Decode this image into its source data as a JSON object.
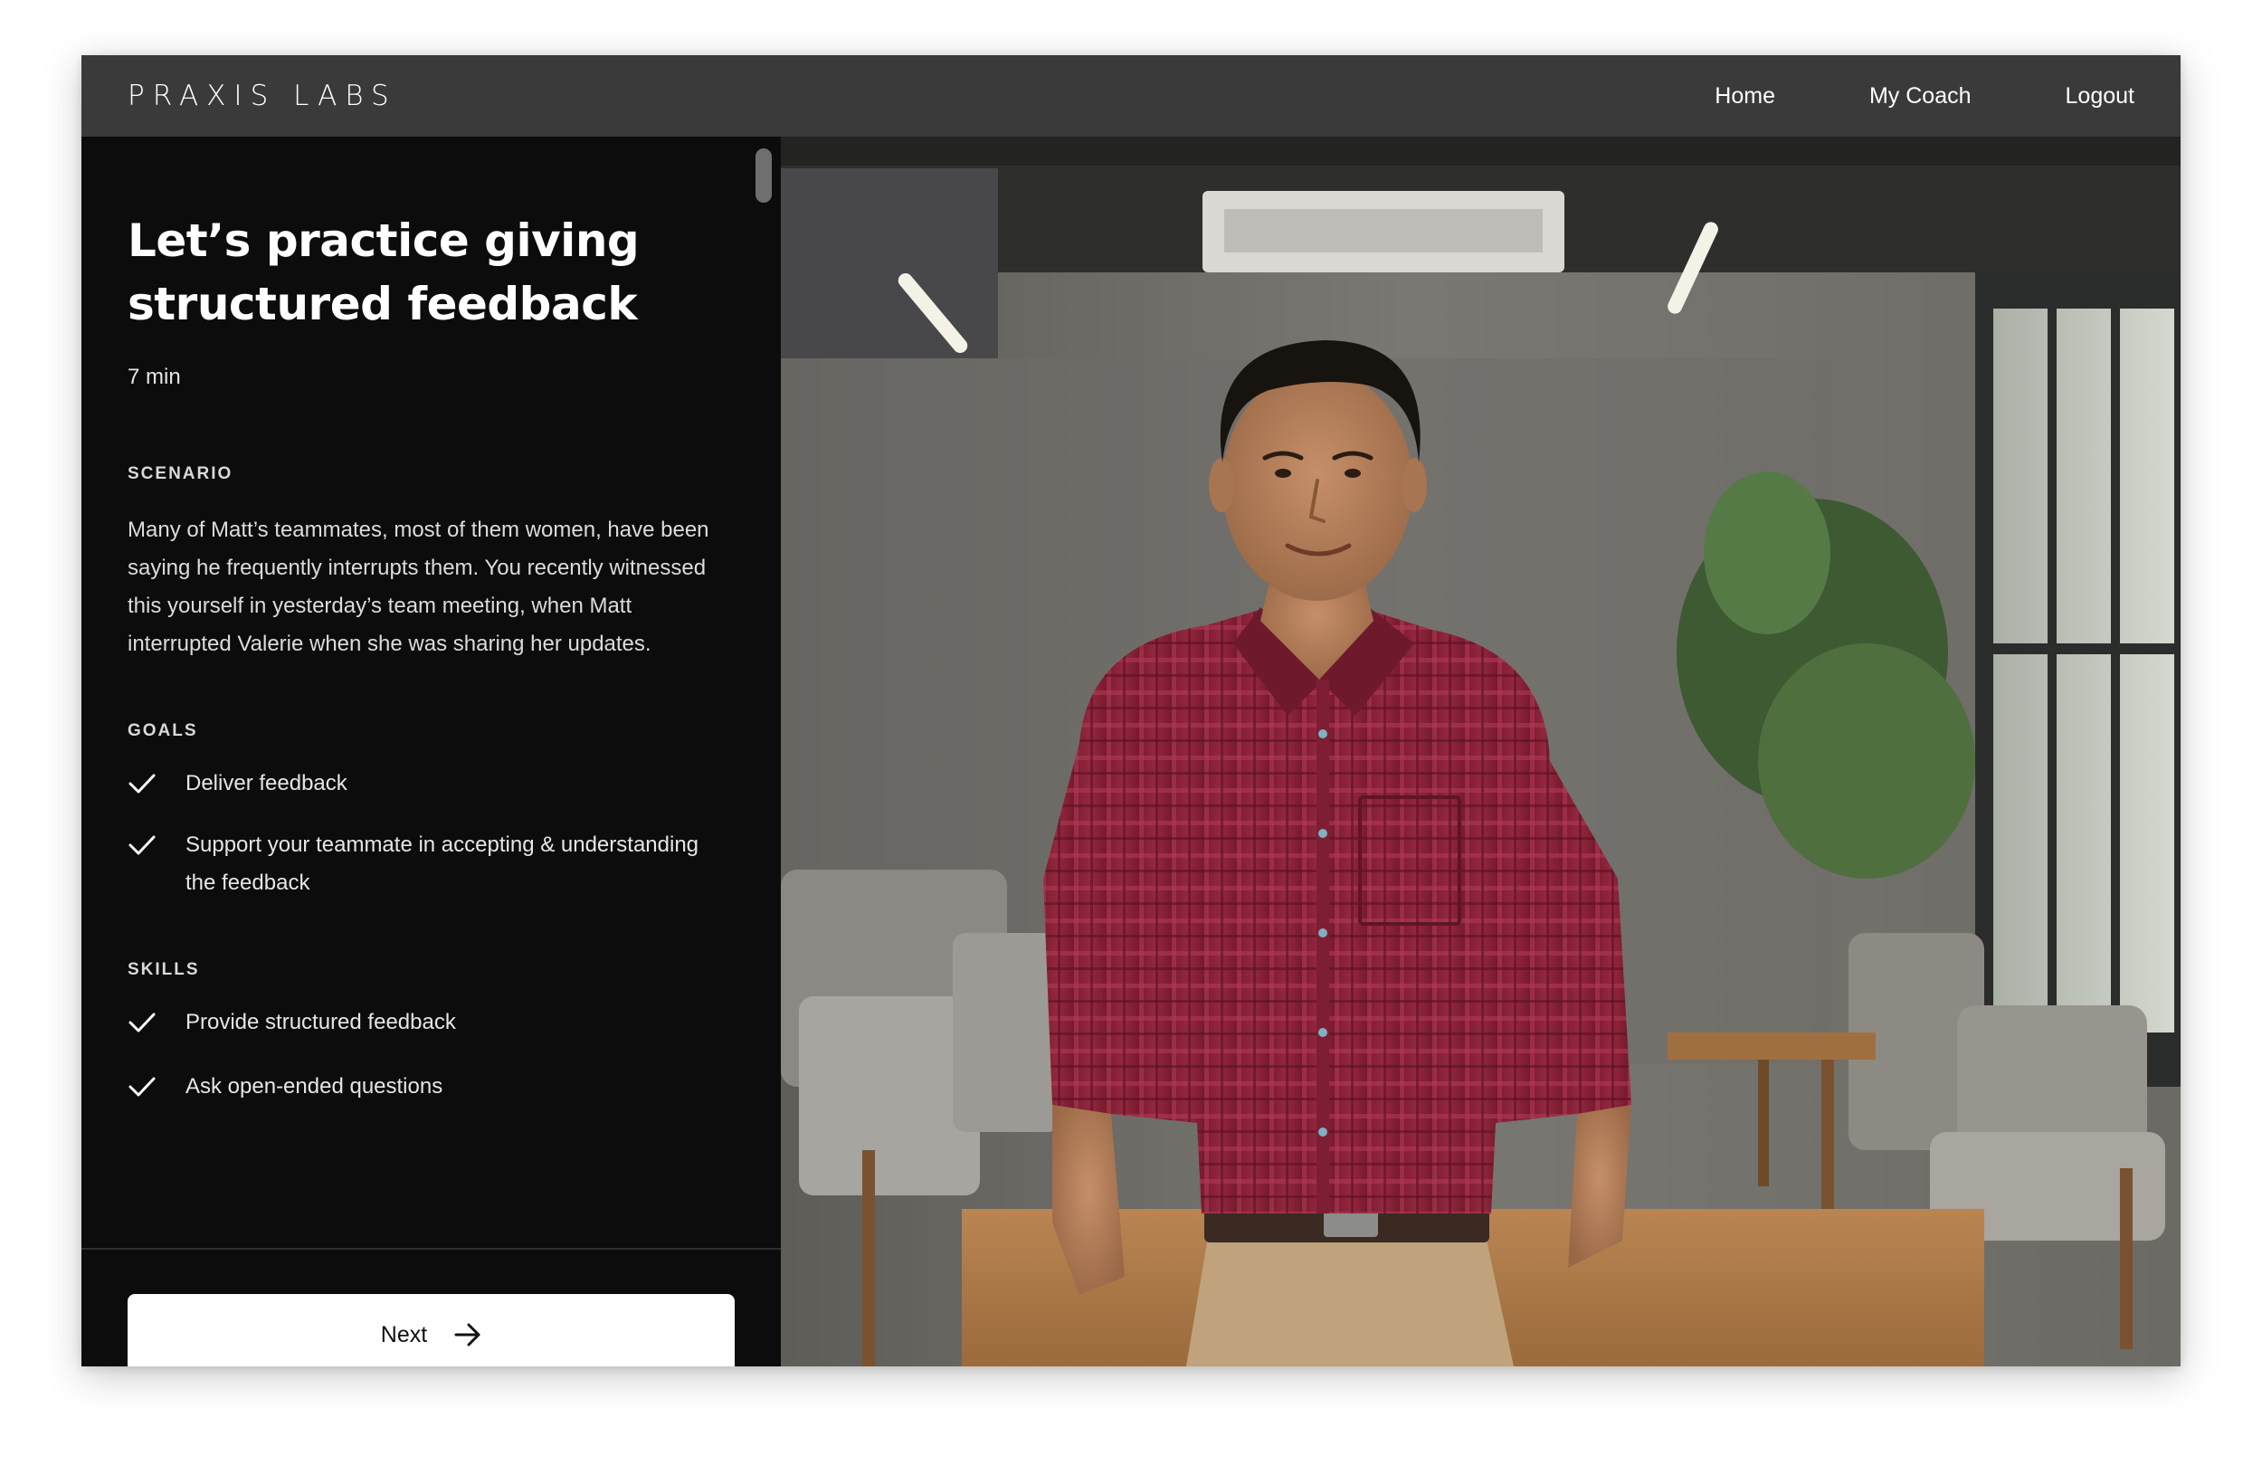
{
  "header": {
    "logo": "PRAXIS LABS",
    "nav": [
      {
        "label": "Home"
      },
      {
        "label": "My Coach"
      },
      {
        "label": "Logout"
      }
    ]
  },
  "lesson": {
    "title": "Let’s practice giving structured feedback",
    "duration": "7 min",
    "scenario_label": "SCENARIO",
    "scenario_text": "Many of Matt’s teammates, most of them women, have been saying he frequently interrupts them. You recently witnessed this yourself in yesterday’s team meeting, when Matt interrupted Valerie when she was sharing her updates.",
    "goals_label": "GOALS",
    "goals": [
      {
        "text": "Deliver feedback"
      },
      {
        "text": "Support your teammate in accepting & understanding the feedback"
      }
    ],
    "skills_label": "SKILLS",
    "skills": [
      {
        "text": "Provide structured feedback"
      },
      {
        "text": "Ask open-ended questions"
      }
    ],
    "next_label": "Next"
  },
  "icons": {
    "check": "check-icon",
    "arrow": "arrow-right-icon"
  },
  "colors": {
    "topbar": "#3a3a3a",
    "panel": "#0c0c0c",
    "button": "#ffffff",
    "shirt": "#8e2238"
  }
}
